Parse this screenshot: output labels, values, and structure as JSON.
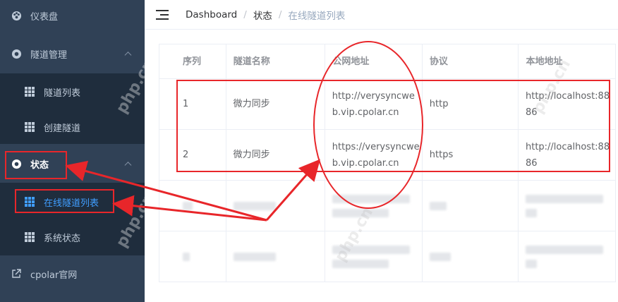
{
  "sidebar": {
    "items": [
      {
        "label": "仪表盘",
        "icon": "dashboard-icon"
      },
      {
        "label": "隧道管理",
        "icon": "tunnel-manage-icon"
      },
      {
        "label": "隧道列表",
        "icon": "grid-icon"
      },
      {
        "label": "创建隧道",
        "icon": "grid-icon"
      },
      {
        "label": "状态",
        "icon": "status-icon"
      },
      {
        "label": "在线隧道列表",
        "icon": "grid-icon"
      },
      {
        "label": "系统状态",
        "icon": "grid-icon"
      },
      {
        "label": "cpolar官网",
        "icon": "external-link-icon"
      }
    ]
  },
  "breadcrumb": {
    "home": "Dashboard",
    "section": "状态",
    "current": "在线隧道列表"
  },
  "table": {
    "headers": [
      "序列",
      "隧道名称",
      "公网地址",
      "协议",
      "本地地址"
    ],
    "rows": [
      {
        "index": "1",
        "name": "微力同步",
        "public_line1": "http://verysyncwe",
        "public_line2": "b.vip.cpolar.cn",
        "protocol": "http",
        "local_line1": "http://localhost:88",
        "local_line2": "86"
      },
      {
        "index": "2",
        "name": "微力同步",
        "public_line1": "https://verysyncwe",
        "public_line2": "b.vip.cpolar.cn",
        "protocol": "https",
        "local_line1": "http://localhost:88",
        "local_line2": "86"
      }
    ]
  },
  "colors": {
    "sidebar_bg": "#304156",
    "submenu_bg": "#1f2d3d",
    "active_text": "#409eff",
    "annotation_red": "#e8262a"
  },
  "watermark": "php.cn"
}
